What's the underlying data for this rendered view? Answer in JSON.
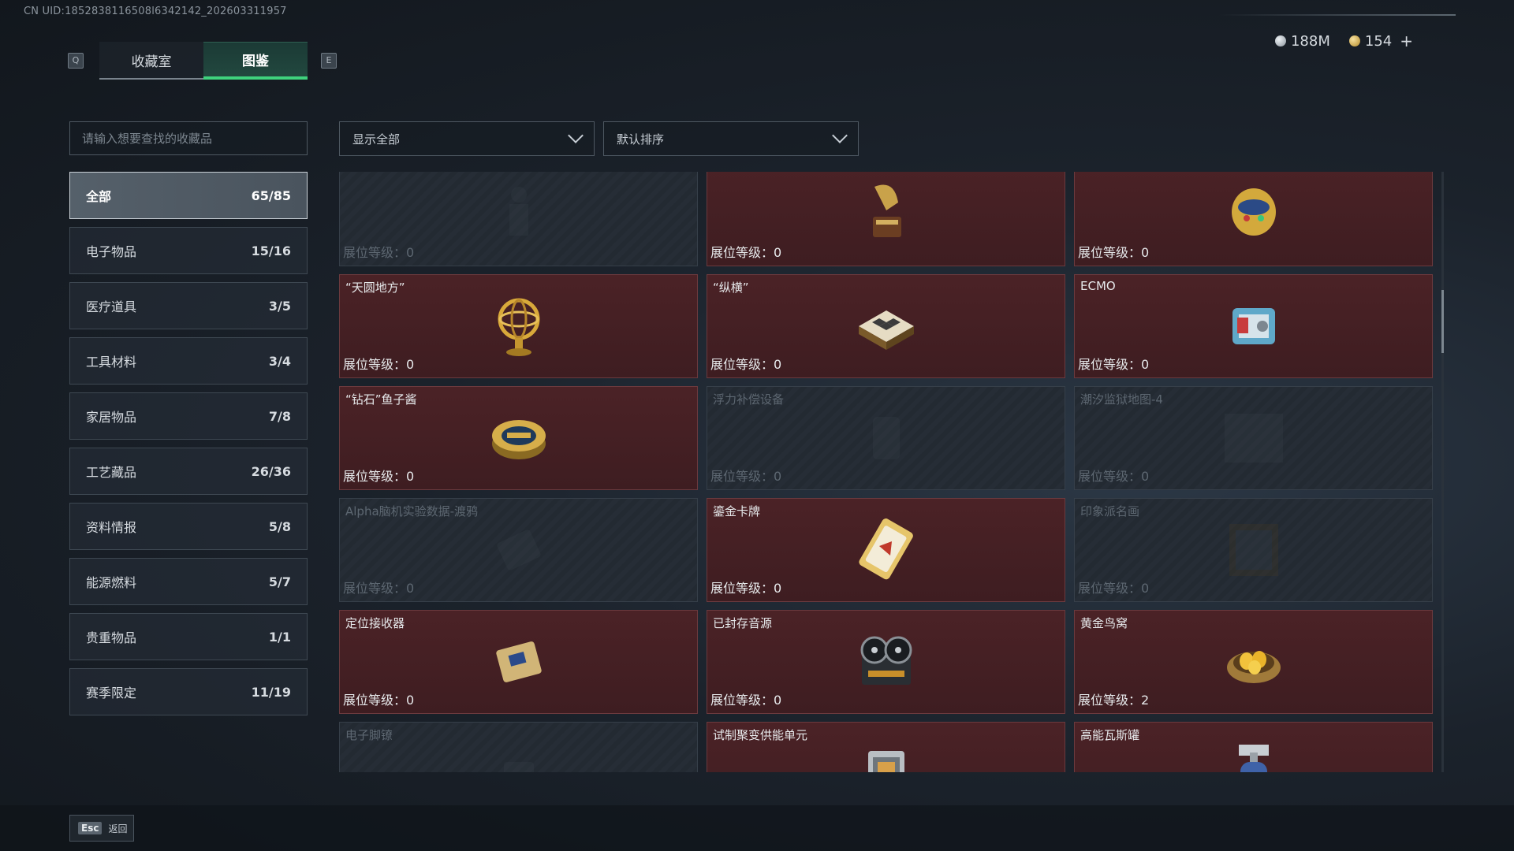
{
  "uid": "CN UID:1852838116508l6342142_202603311957",
  "keys": {
    "left": "Q",
    "right": "E"
  },
  "tabs": [
    {
      "label": "收藏室"
    },
    {
      "label": "图鉴"
    }
  ],
  "currency": {
    "silver": "188M",
    "gold": "154",
    "plus": "+"
  },
  "search": {
    "placeholder": "请输入想要查找的收藏品"
  },
  "filter": {
    "display": "显示全部",
    "sort": "默认排序"
  },
  "categories": [
    {
      "label": "全部",
      "count": "65/85"
    },
    {
      "label": "电子物品",
      "count": "15/16"
    },
    {
      "label": "医疗道具",
      "count": "3/5"
    },
    {
      "label": "工具材料",
      "count": "3/4"
    },
    {
      "label": "家居物品",
      "count": "7/8"
    },
    {
      "label": "工艺藏品",
      "count": "26/36"
    },
    {
      "label": "资料情报",
      "count": "5/8"
    },
    {
      "label": "能源燃料",
      "count": "5/7"
    },
    {
      "label": "贵重物品",
      "count": "1/1"
    },
    {
      "label": "赛季限定",
      "count": "11/19"
    }
  ],
  "items": [
    {
      "name": "",
      "level": "展位等级：0",
      "owned": false,
      "icon": "figure-icon"
    },
    {
      "name": "",
      "level": "展位等级：0",
      "owned": true,
      "icon": "gramophone-icon"
    },
    {
      "name": "",
      "level": "展位等级：0",
      "owned": true,
      "icon": "jeweled-egg-icon"
    },
    {
      "name": "“天圆地方”",
      "level": "展位等级：0",
      "owned": true,
      "icon": "armillary-sphere-icon"
    },
    {
      "name": "“纵横”",
      "level": "展位等级：0",
      "owned": true,
      "icon": "chessboard-icon"
    },
    {
      "name": "ECMO",
      "level": "展位等级：0",
      "owned": true,
      "icon": "ecmo-machine-icon"
    },
    {
      "name": "“钻石”鱼子酱",
      "level": "展位等级：0",
      "owned": true,
      "icon": "caviar-tin-icon"
    },
    {
      "name": "浮力补偿设备",
      "level": "展位等级：0",
      "owned": false,
      "icon": "buoyancy-device-icon"
    },
    {
      "name": "潮汐监狱地图-4",
      "level": "展位等级：0",
      "owned": false,
      "icon": "map-icon"
    },
    {
      "name": "Alpha脑机实验数据-渡鸦",
      "level": "展位等级：0",
      "owned": false,
      "icon": "drive-icon"
    },
    {
      "name": "鎏金卡牌",
      "level": "展位等级：0",
      "owned": true,
      "icon": "gilded-card-icon"
    },
    {
      "name": "印象派名画",
      "level": "展位等级：0",
      "owned": false,
      "icon": "painting-icon"
    },
    {
      "name": "定位接收器",
      "level": "展位等级：0",
      "owned": true,
      "icon": "receiver-icon"
    },
    {
      "name": "已封存音源",
      "level": "展位等级：0",
      "owned": true,
      "icon": "reel-recorder-icon"
    },
    {
      "name": "黄金鸟窝",
      "level": "展位等级：2",
      "owned": true,
      "icon": "golden-nest-icon"
    },
    {
      "name": "电子脚镣",
      "level": "",
      "owned": false,
      "icon": "ankle-monitor-icon"
    },
    {
      "name": "试制聚变供能单元",
      "level": "",
      "owned": true,
      "icon": "fusion-unit-icon"
    },
    {
      "name": "高能瓦斯罐",
      "level": "",
      "owned": true,
      "icon": "gas-canister-icon"
    }
  ],
  "footer": {
    "esc_key": "Esc",
    "back_label": "返回"
  }
}
